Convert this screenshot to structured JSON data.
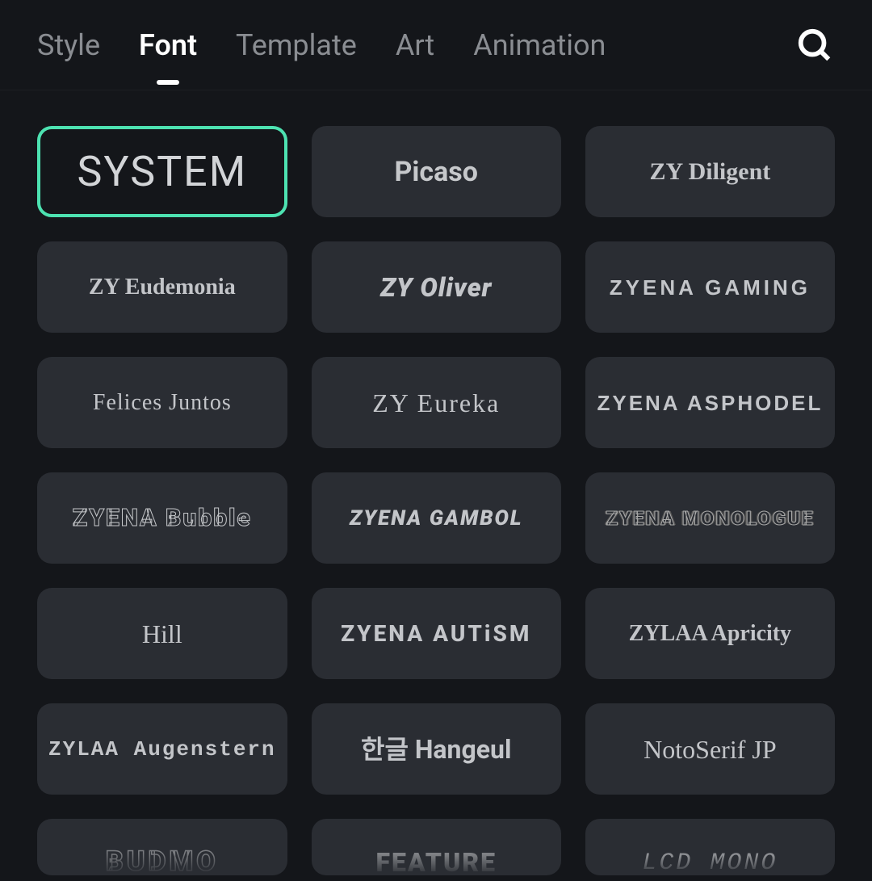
{
  "tabs": [
    {
      "id": "style",
      "label": "Style",
      "active": false
    },
    {
      "id": "font",
      "label": "Font",
      "active": true
    },
    {
      "id": "template",
      "label": "Template",
      "active": false
    },
    {
      "id": "art",
      "label": "Art",
      "active": false
    },
    {
      "id": "animation",
      "label": "Animation",
      "active": false
    }
  ],
  "icons": {
    "search": "search-icon"
  },
  "fonts": [
    {
      "id": "system",
      "label": "SYSTEM",
      "cls": "f-system",
      "selected": true
    },
    {
      "id": "picaso",
      "label": "Picaso",
      "cls": "f-picaso",
      "selected": false
    },
    {
      "id": "diligent",
      "label": "ZY Diligent",
      "cls": "f-diligent",
      "selected": false
    },
    {
      "id": "eudemonia",
      "label": "ZY Eudemonia",
      "cls": "f-eudemonia",
      "selected": false
    },
    {
      "id": "oliver",
      "label": "ZY Oliver",
      "cls": "f-oliver",
      "selected": false
    },
    {
      "id": "gaming",
      "label": "ZYENA GAMING",
      "cls": "f-gaming",
      "selected": false
    },
    {
      "id": "felices",
      "label": "Felices Juntos",
      "cls": "f-felices",
      "selected": false
    },
    {
      "id": "eureka",
      "label": "ZY Eureka",
      "cls": "f-eureka",
      "selected": false
    },
    {
      "id": "asphodel",
      "label": "ZYENA ASPHODEL",
      "cls": "f-asphodel",
      "selected": false
    },
    {
      "id": "bubble",
      "label": "ZYENA Bubble",
      "cls": "f-bubble",
      "selected": false
    },
    {
      "id": "gambol",
      "label": "ZYENA GAMBOL",
      "cls": "f-gambol",
      "selected": false
    },
    {
      "id": "monologue",
      "label": "ZYENA MONOLOGUE",
      "cls": "f-monologue",
      "selected": false
    },
    {
      "id": "hill",
      "label": "Hill",
      "cls": "f-hill",
      "selected": false
    },
    {
      "id": "autism",
      "label": "ZYENA AUTiSM",
      "cls": "f-autism",
      "selected": false
    },
    {
      "id": "apricity",
      "label": "ZYLAA Apricity",
      "cls": "f-apricity",
      "selected": false
    },
    {
      "id": "augenstern",
      "label": "ZYLAA Augenstern",
      "cls": "f-augenstern",
      "selected": false
    },
    {
      "id": "hangeul",
      "label": "한글 Hangeul",
      "cls": "f-hangeul",
      "selected": false
    },
    {
      "id": "notoserif",
      "label": "NotoSerif JP",
      "cls": "f-notoserif",
      "selected": false
    },
    {
      "id": "budmo",
      "label": "BUDMO",
      "cls": "f-budmo",
      "selected": false,
      "cut": true
    },
    {
      "id": "feature",
      "label": "FEATURE",
      "cls": "f-feature",
      "selected": false,
      "cut": true
    },
    {
      "id": "lcd",
      "label": "LCD MONO",
      "cls": "f-lcd",
      "selected": false,
      "cut": true
    }
  ]
}
